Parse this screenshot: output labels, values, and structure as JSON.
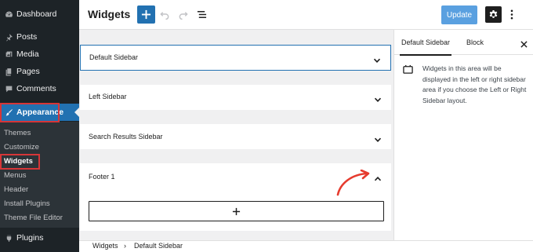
{
  "admin_menu": {
    "dashboard": "Dashboard",
    "posts": "Posts",
    "media": "Media",
    "pages": "Pages",
    "comments": "Comments",
    "appearance": "Appearance",
    "plugins": "Plugins",
    "appearance_submenu": [
      "Themes",
      "Customize",
      "Widgets",
      "Menus",
      "Header",
      "Install Plugins",
      "Theme File Editor"
    ],
    "current_submenu": "Widgets"
  },
  "header": {
    "title": "Widgets",
    "update_label": "Update",
    "icons": [
      "plus-icon",
      "undo-icon",
      "redo-icon",
      "list-view-icon",
      "gear-icon",
      "more-vertical-icon"
    ]
  },
  "widget_areas": [
    {
      "title": "Default Sidebar",
      "selected": true,
      "expanded": false
    },
    {
      "title": "Left Sidebar",
      "selected": false,
      "expanded": false
    },
    {
      "title": "Search Results Sidebar",
      "selected": false,
      "expanded": false
    },
    {
      "title": "Footer 1",
      "selected": false,
      "expanded": true
    }
  ],
  "inspector": {
    "tab_active": "Default Sidebar",
    "tab_block": "Block",
    "description": "Widgets in this area will be displayed in the left or right sidebar area if you choose the Left or Right Sidebar layout."
  },
  "breadcrumb": {
    "root": "Widgets",
    "separator": "›",
    "current": "Default Sidebar"
  },
  "colors": {
    "admin_bg": "#1d2327",
    "accent": "#2271b1",
    "highlight_red": "#d63638",
    "update_button": "#5aa0e0"
  }
}
